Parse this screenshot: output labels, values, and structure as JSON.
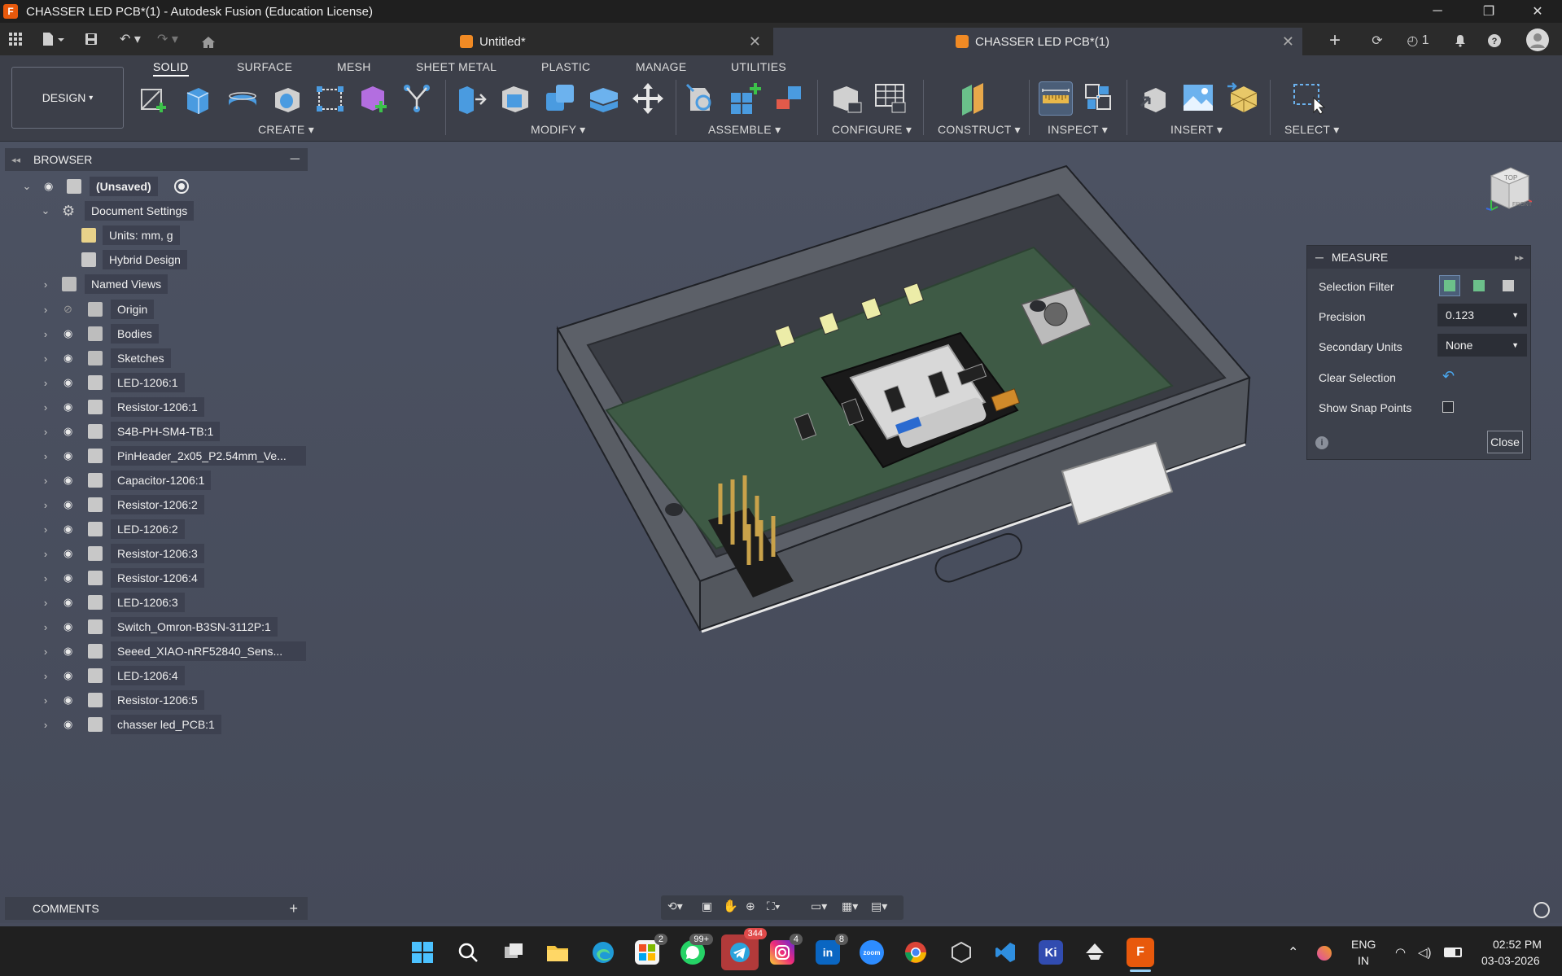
{
  "window": {
    "title": "CHASSER LED PCB*(1) - Autodesk Fusion (Education License)",
    "app_icon": "F"
  },
  "quick_access": {
    "jobs_count": "1"
  },
  "tabs": [
    {
      "label": "Untitled*"
    },
    {
      "label": "CHASSER LED PCB*(1)"
    }
  ],
  "workspace": {
    "label": "DESIGN",
    "chevron": "▾"
  },
  "ribbon_tabs": [
    "SOLID",
    "SURFACE",
    "MESH",
    "SHEET METAL",
    "PLASTIC",
    "MANAGE",
    "UTILITIES"
  ],
  "ribbon_groups": [
    "CREATE ▾",
    "MODIFY ▾",
    "ASSEMBLE ▾",
    "CONFIGURE ▾",
    "CONSTRUCT ▾",
    "INSPECT ▾",
    "INSERT ▾",
    "SELECT ▾"
  ],
  "browser": {
    "title": "BROWSER",
    "root": "(Unsaved)",
    "doc_settings": "Document Settings",
    "units": "Units: mm, g",
    "hybrid": "Hybrid Design",
    "named_views": "Named Views",
    "items": [
      {
        "label": "Origin"
      },
      {
        "label": "Bodies"
      },
      {
        "label": "Sketches"
      },
      {
        "label": "LED-1206:1"
      },
      {
        "label": "Resistor-1206:1"
      },
      {
        "label": "S4B-PH-SM4-TB:1"
      },
      {
        "label": "PinHeader_2x05_P2.54mm_Ve..."
      },
      {
        "label": "Capacitor-1206:1"
      },
      {
        "label": "Resistor-1206:2"
      },
      {
        "label": "LED-1206:2"
      },
      {
        "label": "Resistor-1206:3"
      },
      {
        "label": "Resistor-1206:4"
      },
      {
        "label": "LED-1206:3"
      },
      {
        "label": "Switch_Omron-B3SN-3112P:1"
      },
      {
        "label": "Seeed_XIAO-nRF52840_Sens..."
      },
      {
        "label": "LED-1206:4"
      },
      {
        "label": "Resistor-1206:5"
      },
      {
        "label": "chasser led_PCB:1"
      }
    ]
  },
  "measure": {
    "title": "MEASURE",
    "selection_filter": "Selection Filter",
    "precision_label": "Precision",
    "precision_value": "0.123",
    "secondary_units_label": "Secondary Units",
    "secondary_units_value": "None",
    "clear_selection": "Clear Selection",
    "show_snap_points": "Show Snap Points",
    "close": "Close"
  },
  "viewcube": {
    "top": "TOP",
    "front": "FRONT"
  },
  "comments": {
    "title": "COMMENTS"
  },
  "taskbar": {
    "badges": {
      "phone_link": "2",
      "whatsapp": "99+",
      "telegram": "344",
      "instagram": "4",
      "linkedin": "8"
    },
    "zoom_label": "zoom",
    "lang": "ENG",
    "region": "IN",
    "time": "02:52 PM",
    "date": "03-03-2026"
  },
  "colors": {
    "accent": "#f08a24",
    "ribbon": "#3c3f49",
    "viewport": "#4a4f5e",
    "pcb": "#3e5a45"
  }
}
